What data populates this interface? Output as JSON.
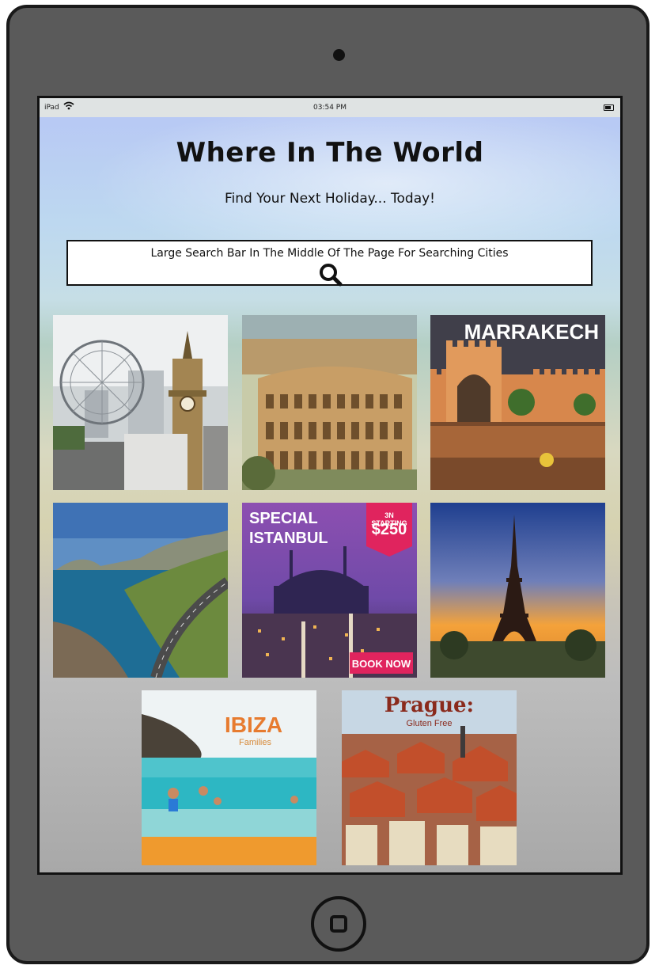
{
  "status_bar": {
    "carrier": "iPad",
    "time": "03:54 PM"
  },
  "header": {
    "title": "Where In The World",
    "subtitle": "Find Your Next Holiday... Today!"
  },
  "search": {
    "placeholder": "Large Search Bar In The Middle Of The Page For Searching Cities",
    "icon": "search-icon"
  },
  "destinations": [
    {
      "id": "london",
      "caption": ""
    },
    {
      "id": "rome",
      "caption": ""
    },
    {
      "id": "marrakech",
      "caption": "MARRAKECH"
    },
    {
      "id": "cape-town",
      "caption": ""
    },
    {
      "id": "istanbul",
      "caption_line1": "SPECIAL",
      "caption_line2": "ISTANBUL",
      "price_prefix": "3N STARTING",
      "price": "$250",
      "cta": "BOOK NOW"
    },
    {
      "id": "paris",
      "caption": ""
    },
    {
      "id": "ibiza",
      "caption": "IBIZA",
      "sub": "Families"
    },
    {
      "id": "prague",
      "caption": "Prague:",
      "sub": "Gluten Free"
    }
  ]
}
